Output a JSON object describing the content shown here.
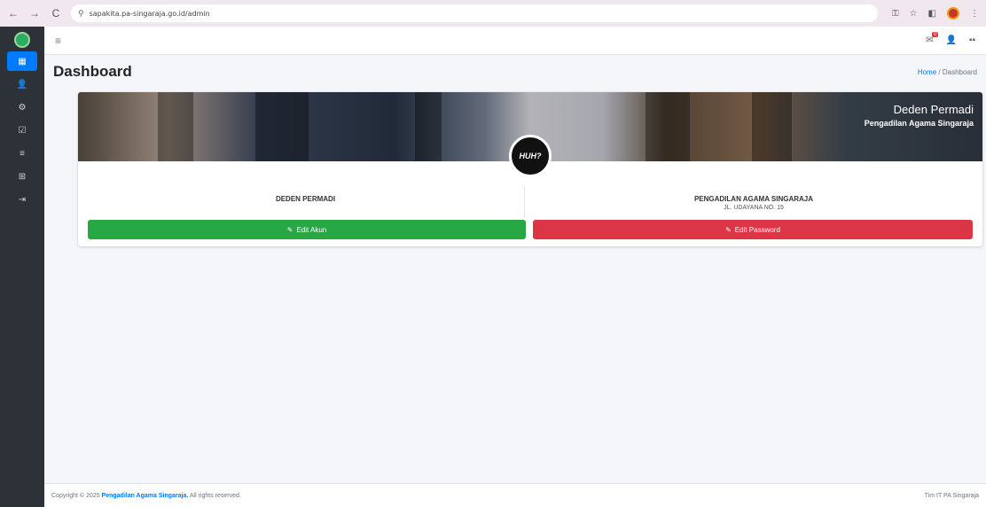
{
  "browser": {
    "url": "sapakita.pa-singaraja.go.id/admin",
    "back_icon": "←",
    "forward_icon": "→",
    "reload_icon": "C"
  },
  "sidebar": {
    "items": [
      {
        "icon": "▦",
        "name": "dashboard"
      },
      {
        "icon": "👤",
        "name": "user"
      },
      {
        "icon": "⚙",
        "name": "users-cog"
      },
      {
        "icon": "☑",
        "name": "clipboard"
      },
      {
        "icon": "≡",
        "name": "database"
      },
      {
        "icon": "⊞",
        "name": "table"
      },
      {
        "icon": "⇥",
        "name": "logout"
      }
    ]
  },
  "navbar": {
    "menu_icon": "≡",
    "notif_icon": "✉",
    "notif_badge": "0",
    "user_icon": "👤",
    "grid_icon": "▪▪"
  },
  "header": {
    "title": "Dashboard",
    "breadcrumb_home": "Home",
    "breadcrumb_sep": "/",
    "breadcrumb_current": "Dashboard"
  },
  "profile": {
    "banner_name": "Deden Permadi",
    "banner_org": "Pengadilan Agama Singaraja",
    "avatar_text": "HUH?",
    "left_title": "DEDEN PERMADI",
    "right_title": "PENGADILAN AGAMA SINGARAJA",
    "right_sub": "JL. UDAYANA NO. 15",
    "edit_account_label": "Edit Akun",
    "edit_password_label": "Edit Password",
    "edit_icon": "✎"
  },
  "footer": {
    "copyright_prefix": "Copyright © 2025",
    "brand": "Pengadilan Agama Singaraja.",
    "rights": "All rights reserved.",
    "right_text": "Tim IT PA Singaraja"
  },
  "colors": {
    "primary": "#007bff",
    "success": "#28a745",
    "danger": "#dc3545",
    "sidebar": "#2c3237"
  }
}
